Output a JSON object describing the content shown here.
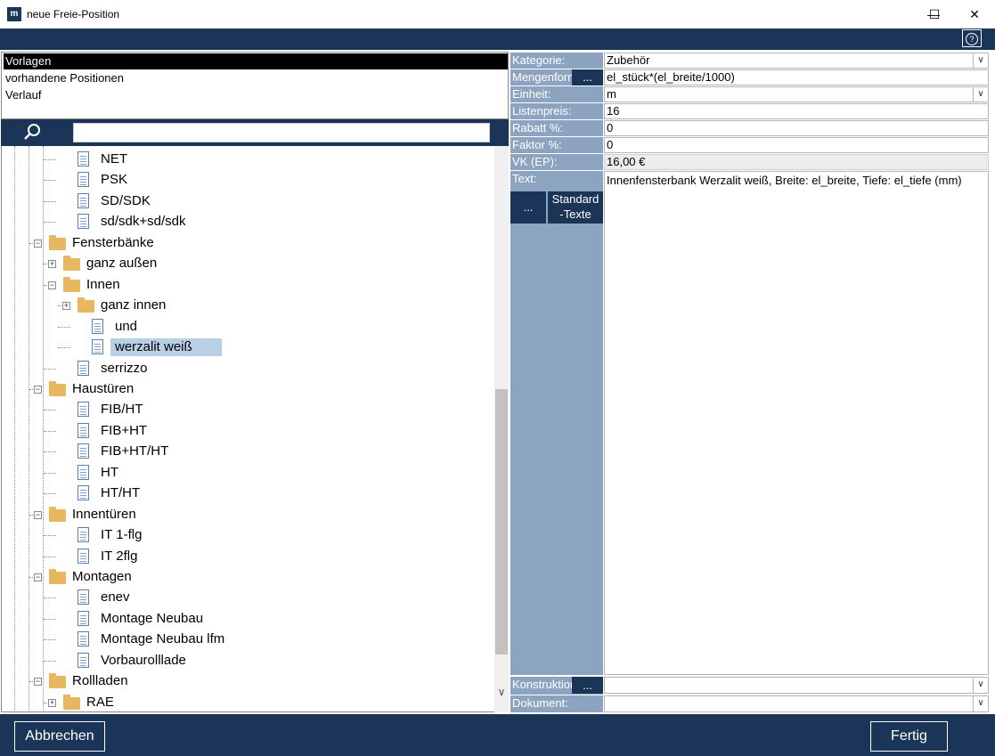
{
  "window": {
    "logo": "m",
    "title": "neue Freie-Position",
    "minimize": "—",
    "maximize": "☐",
    "close": "✕",
    "help": "?"
  },
  "template_list": [
    "Vorlagen",
    "vorhandene Positionen",
    "Verlauf"
  ],
  "search": {
    "placeholder": ""
  },
  "tree": [
    {
      "label": "NET",
      "type": "doc"
    },
    {
      "label": "PSK",
      "type": "doc"
    },
    {
      "label": "SD/SDK",
      "type": "doc"
    },
    {
      "label": "sd/sdk+sd/sdk",
      "type": "doc"
    },
    {
      "label": "Fensterbänke",
      "type": "folder",
      "expanded": true
    },
    {
      "label": "ganz außen",
      "type": "folder",
      "expanded": false
    },
    {
      "label": "Innen",
      "type": "folder",
      "expanded": true
    },
    {
      "label": "ganz innen",
      "type": "folder",
      "expanded": false
    },
    {
      "label": "und",
      "type": "doc"
    },
    {
      "label": "werzalit weiß",
      "type": "doc",
      "selected": true
    },
    {
      "label": "serrizzo",
      "type": "doc"
    },
    {
      "label": "Haustüren",
      "type": "folder",
      "expanded": true
    },
    {
      "label": "FIB/HT",
      "type": "doc"
    },
    {
      "label": "FIB+HT",
      "type": "doc"
    },
    {
      "label": "FIB+HT/HT",
      "type": "doc"
    },
    {
      "label": "HT",
      "type": "doc"
    },
    {
      "label": "HT/HT",
      "type": "doc"
    },
    {
      "label": "Innentüren",
      "type": "folder",
      "expanded": true
    },
    {
      "label": "IT 1-flg",
      "type": "doc"
    },
    {
      "label": "IT 2flg",
      "type": "doc"
    },
    {
      "label": "Montagen",
      "type": "folder",
      "expanded": true
    },
    {
      "label": "enev",
      "type": "doc"
    },
    {
      "label": "Montage Neubau",
      "type": "doc"
    },
    {
      "label": "Montage Neubau lfm",
      "type": "doc"
    },
    {
      "label": "Vorbaurolllade",
      "type": "doc"
    },
    {
      "label": "Rollladen",
      "type": "folder",
      "expanded": true
    },
    {
      "label": "RAE",
      "type": "folder",
      "expanded": false
    }
  ],
  "form": {
    "kategorie_label": "Kategorie:",
    "kategorie_value": "Zubehör",
    "mengenformel_label": "Mengenformel:",
    "mengenformel_value": "el_stück*(el_breite/1000)",
    "einheit_label": "Einheit:",
    "einheit_value": "m",
    "listenpreis_label": "Listenpreis:",
    "listenpreis_value": "16",
    "rabatt_label": "Rabatt %:",
    "rabatt_value": "0",
    "faktor_label": "Faktor %:",
    "faktor_value": "0",
    "vk_label": "VK (EP):",
    "vk_value": "16,00 €",
    "text_label": "Text:",
    "text_value": "Innenfensterbank Werzalit weiß, Breite: el_breite, Tiefe: el_tiefe (mm)",
    "dots": "...",
    "standard_texte_line1": "Standard",
    "standard_texte_line2": "-Texte",
    "konstruktion_label": "Konstruktion:",
    "konstruktion_value": "",
    "dokument_label": "Dokument:",
    "dokument_value": ""
  },
  "buttons": {
    "cancel": "Abbrechen",
    "finish": "Fertig"
  },
  "icons": {
    "search": "search-icon",
    "dropdown": "chevron-down-icon",
    "scroll_down": "chevron-down-icon"
  },
  "colors": {
    "navy": "#1b3558",
    "label_bg": "#8da4c0",
    "selection": "#b8cfe6"
  }
}
